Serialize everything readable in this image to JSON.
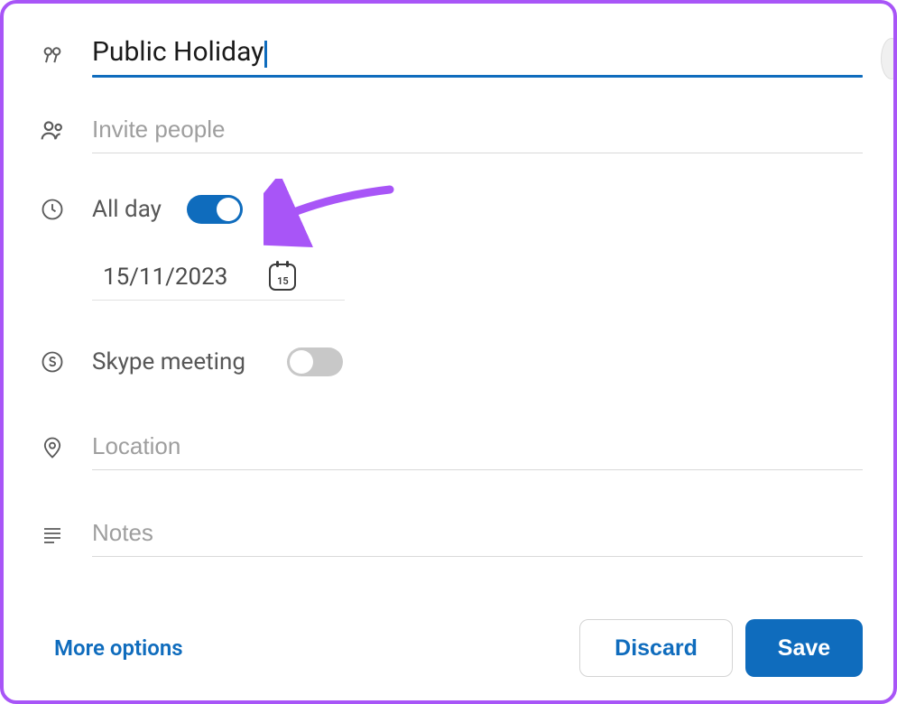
{
  "title": {
    "value": "Public Holiday"
  },
  "invite": {
    "placeholder": "Invite people"
  },
  "allday": {
    "label": "All day",
    "on": true
  },
  "date": {
    "value": "15/11/2023",
    "iconDay": "15"
  },
  "skype": {
    "label": "Skype meeting",
    "on": false
  },
  "location": {
    "placeholder": "Location"
  },
  "notes": {
    "placeholder": "Notes"
  },
  "footer": {
    "moreOptions": "More options",
    "discard": "Discard",
    "save": "Save"
  },
  "colors": {
    "accent": "#0f6cbd",
    "annotation": "#a855f7"
  }
}
